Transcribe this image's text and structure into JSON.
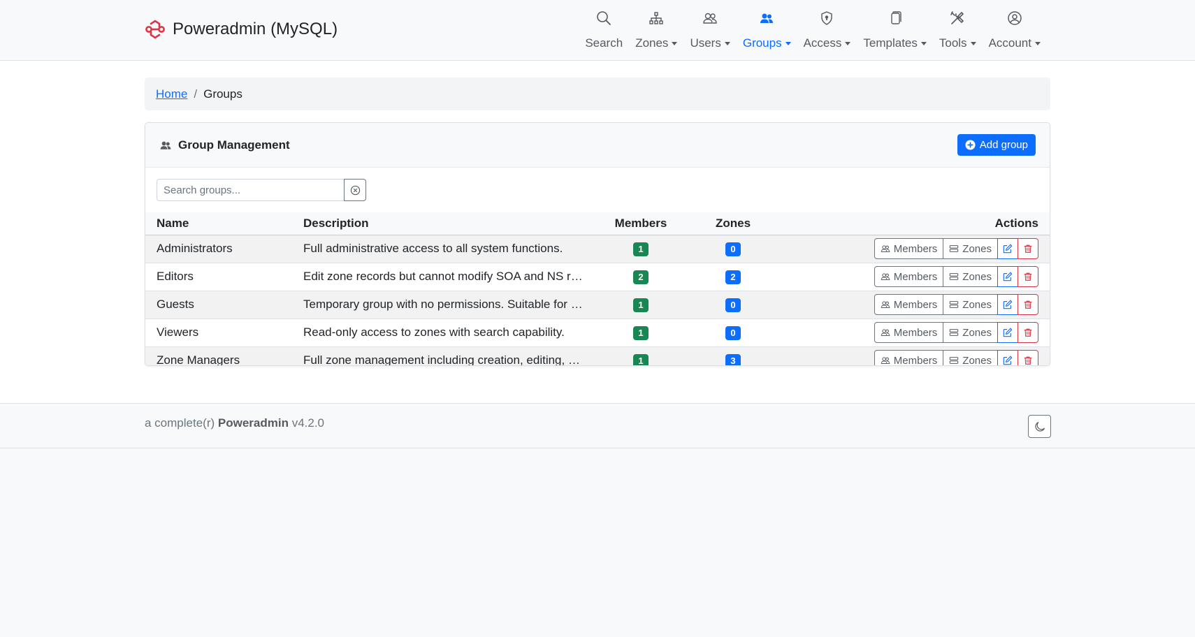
{
  "brand": {
    "title": "Poweradmin (MySQL)",
    "logo_color": "#dc3545"
  },
  "nav": {
    "items": [
      {
        "label": "Search",
        "icon": "search-icon",
        "has_caret": false
      },
      {
        "label": "Zones",
        "icon": "sitemap-icon",
        "has_caret": true
      },
      {
        "label": "Users",
        "icon": "users-icon",
        "has_caret": true
      },
      {
        "label": "Groups",
        "icon": "people-fill-icon",
        "has_caret": true,
        "active": true
      },
      {
        "label": "Access",
        "icon": "shield-icon",
        "has_caret": true
      },
      {
        "label": "Templates",
        "icon": "copy-icon",
        "has_caret": true
      },
      {
        "label": "Tools",
        "icon": "tools-icon",
        "has_caret": true
      },
      {
        "label": "Account",
        "icon": "person-circle-icon",
        "has_caret": true
      }
    ]
  },
  "breadcrumb": {
    "home": "Home",
    "separator": "/",
    "current": "Groups"
  },
  "card": {
    "title": "Group Management",
    "add_button": "Add group",
    "search_placeholder": "Search groups..."
  },
  "table": {
    "headers": {
      "name": "Name",
      "description": "Description",
      "members": "Members",
      "zones": "Zones",
      "actions": "Actions"
    },
    "action_labels": {
      "members": "Members",
      "zones": "Zones"
    },
    "rows": [
      {
        "name": "Administrators",
        "description": "Full administrative access to all system functions.",
        "members": "1",
        "zones": "0"
      },
      {
        "name": "Editors",
        "description": "Edit zone records but cannot modify SOA and NS rec...",
        "members": "2",
        "zones": "2"
      },
      {
        "name": "Guests",
        "description": "Temporary group with no permissions. Suitable for us...",
        "members": "1",
        "zones": "0"
      },
      {
        "name": "Viewers",
        "description": "Read-only access to zones with search capability.",
        "members": "1",
        "zones": "0"
      },
      {
        "name": "Zone Managers",
        "description": "Full zone management including creation, editing, an...",
        "members": "1",
        "zones": "3"
      }
    ]
  },
  "colors": {
    "primary": "#0d6efd",
    "success": "#198754",
    "danger": "#dc3545"
  },
  "footer": {
    "prefix": "a complete(r)",
    "product": "Poweradmin",
    "version": "v4.2.0"
  }
}
